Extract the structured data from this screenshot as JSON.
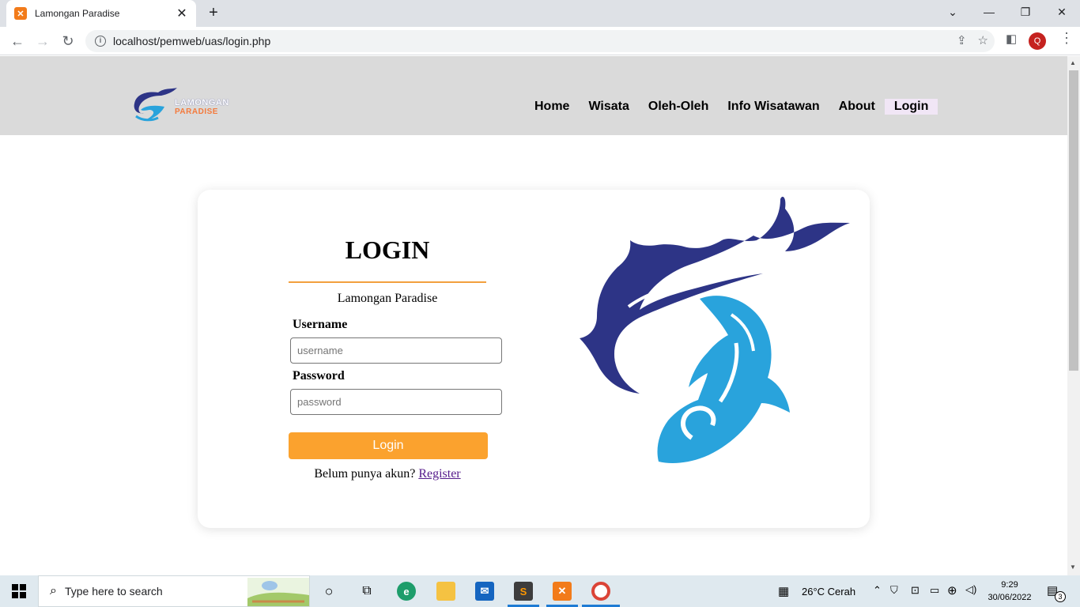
{
  "browser": {
    "tab_title": "Lamongan Paradise",
    "url": "localhost/pemweb/uas/login.php",
    "profile_initial": "Q"
  },
  "site": {
    "logo_line1": "LAMONGAN",
    "logo_line2": "PARADISE",
    "nav": [
      "Home",
      "Wisata",
      "Oleh-Oleh",
      "Info Wisatawan",
      "About",
      "Login"
    ],
    "active_nav": "Login"
  },
  "login": {
    "title": "LOGIN",
    "subtitle": "Lamongan Paradise",
    "username_label": "Username",
    "username_placeholder": "username",
    "password_label": "Password",
    "password_placeholder": "password",
    "button_label": "Login",
    "register_prompt": "Belum punya akun?",
    "register_link": "Register"
  },
  "taskbar": {
    "search_placeholder": "Type here to search",
    "weather": "26°C  Cerah",
    "time": "9:29",
    "date": "30/06/2022",
    "notification_count": "3"
  },
  "colors": {
    "accent_orange": "#fba22e",
    "logo_dark_blue": "#2d3486",
    "logo_light_blue": "#29a3dc",
    "header_gray": "#dadada"
  }
}
